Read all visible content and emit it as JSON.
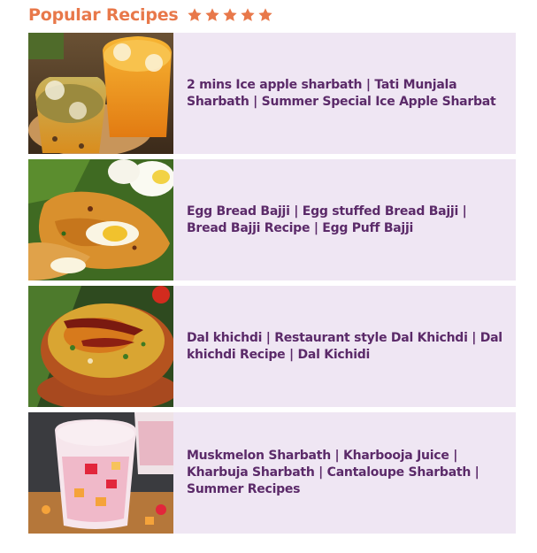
{
  "widget": {
    "title": "Popular Recipes",
    "rating_stars": 5,
    "star_color": "#e8784a",
    "title_color": "#e8784a",
    "item_background": "#efe6f3",
    "item_text_color": "#5b2a69"
  },
  "recipes": [
    {
      "title": "2 mins Ice apple sharbath | Tati Munjala Sharbath | Summer Special Ice Apple Sharbat",
      "thumbnail": "ice-apple-sharbath-glasses-image"
    },
    {
      "title": "Egg Bread Bajji | Egg stuffed Bread Bajji | Bread Bajji Recipe | Egg Puff Bajji",
      "thumbnail": "egg-bread-bajji-image"
    },
    {
      "title": "Dal khichdi | Restaurant style Dal Khichdi | Dal khichdi Recipe | Dal Kichidi",
      "thumbnail": "dal-khichdi-clay-pot-image"
    },
    {
      "title": "Muskmelon Sharbath | Kharbooja Juice | Kharbuja Sharbath | Cantaloupe Sharbath | Summer Recipes",
      "thumbnail": "muskmelon-sharbath-glasses-image"
    }
  ]
}
